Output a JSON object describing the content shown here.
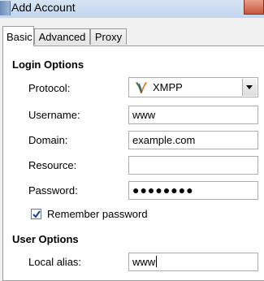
{
  "window": {
    "title": "Add Account"
  },
  "tabs": [
    {
      "label": "Basic"
    },
    {
      "label": "Advanced"
    },
    {
      "label": "Proxy"
    }
  ],
  "login_options": {
    "heading": "Login Options",
    "protocol_label": "Protocol:",
    "protocol_value": "XMPP",
    "username_label": "Username:",
    "username_value": "www",
    "domain_label": "Domain:",
    "domain_value": "example.com",
    "resource_label": "Resource:",
    "resource_value": "",
    "password_label": "Password:",
    "password_value": "●●●●●●●●",
    "remember_label": "Remember password",
    "remember_checked": true
  },
  "user_options": {
    "heading": "User Options",
    "alias_label": "Local alias:",
    "alias_value": "www"
  },
  "icons": {
    "protocol_icon": "xmpp-icon",
    "checkbox_icon": "checkmark-icon",
    "dropdown_icon": "chevron-down-icon"
  }
}
